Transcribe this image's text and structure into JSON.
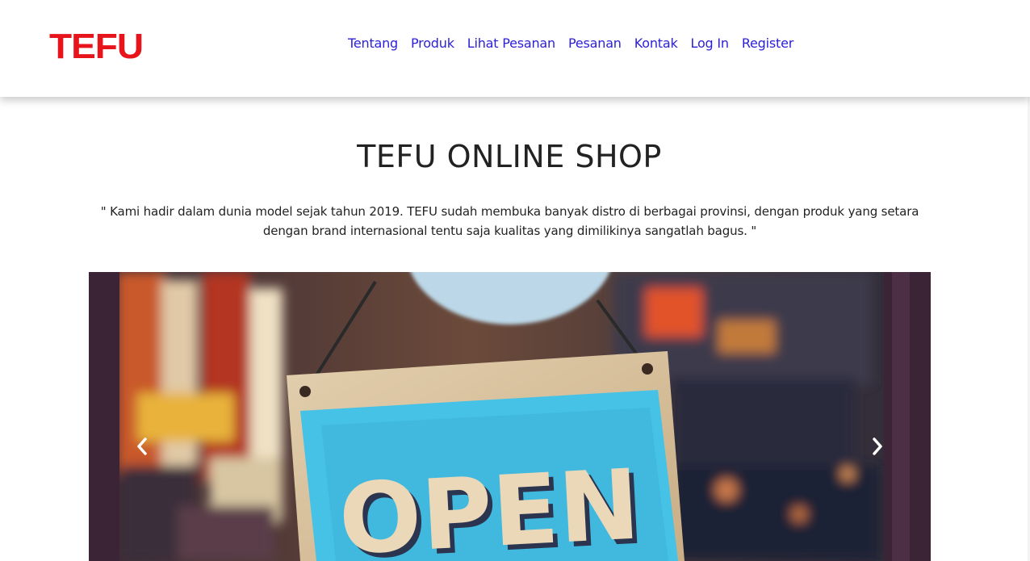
{
  "brand": {
    "name": "TEFU",
    "color": "#e8141b"
  },
  "nav": {
    "link_color": "#2d21d6",
    "items": [
      {
        "label": "Tentang"
      },
      {
        "label": "Produk"
      },
      {
        "label": "Lihat Pesanan"
      },
      {
        "label": "Pesanan"
      },
      {
        "label": "Kontak"
      },
      {
        "label": "Log In"
      },
      {
        "label": "Register"
      }
    ]
  },
  "hero": {
    "title": "TEFU ONLINE SHOP",
    "text": "\" Kami hadir dalam dunia model sejak tahun 2019. TEFU sudah membuka banyak distro di berbagai provinsi, dengan produk yang setara dengan brand internasional tentu saja kualitas yang dimilikinya sangatlah bagus. \"",
    "text_color": "#222222"
  },
  "carousel": {
    "slide_sign_text": "OPEN",
    "prev_icon": "chevron-left-icon",
    "next_icon": "chevron-right-icon"
  }
}
